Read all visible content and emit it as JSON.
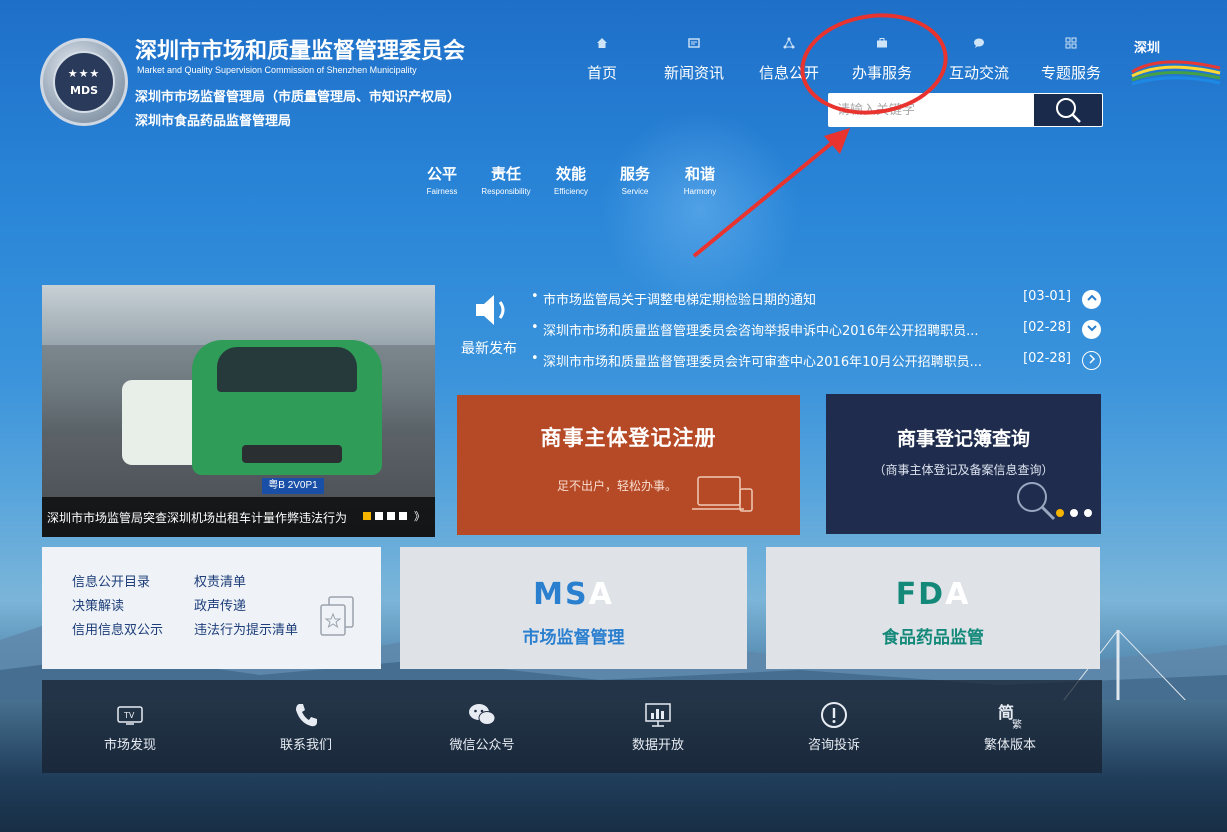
{
  "org": {
    "name_cn": "深圳市市场和质量监督管理委员会",
    "name_en": "Market and Quality Supervision Commission of Shenzhen Municipality",
    "sub1": "深圳市市场监督管理局（市质量管理局、市知识产权局）",
    "sub2": "深圳市食品药品监督管理局",
    "logo_text": "MDS"
  },
  "nav": [
    {
      "label": "首页",
      "icon": "home-icon"
    },
    {
      "label": "新闻资讯",
      "icon": "news-icon"
    },
    {
      "label": "信息公开",
      "icon": "share-icon"
    },
    {
      "label": "办事服务",
      "icon": "briefcase-icon"
    },
    {
      "label": "互动交流",
      "icon": "chat-icon"
    },
    {
      "label": "专题服务",
      "icon": "grid-icon"
    }
  ],
  "search": {
    "placeholder": "请输入关键字"
  },
  "values": [
    {
      "cn": "公平",
      "en": "Fairness"
    },
    {
      "cn": "责任",
      "en": "Responsibility"
    },
    {
      "cn": "效能",
      "en": "Efficiency"
    },
    {
      "cn": "服务",
      "en": "Service"
    },
    {
      "cn": "和谐",
      "en": "Harmony"
    }
  ],
  "carousel": {
    "caption": "深圳市市场监管局突查深圳机场出租车计量作弊违法行为",
    "plate": "粤B 2V0P1",
    "next": "》"
  },
  "news": {
    "label": "最新发布",
    "items": [
      {
        "title": "市市场监管局关于调整电梯定期检验日期的通知",
        "date": "[03-01]"
      },
      {
        "title": "深圳市市场和质量监督管理委员会咨询举报申诉中心2016年公开招聘职员...",
        "date": "[02-28]"
      },
      {
        "title": "深圳市市场和质量监督管理委员会许可审查中心2016年10月公开招聘职员...",
        "date": "[02-28]"
      }
    ]
  },
  "tiles": {
    "register": {
      "title": "商事主体登记注册",
      "sub": "足不出户，轻松办事。"
    },
    "query": {
      "title": "商事登记簿查询",
      "sub": "（商事主体登记及备案信息查询）"
    },
    "links": [
      "信息公开目录",
      "权责清单",
      "决策解读",
      "政声传递",
      "信用信息双公示",
      "违法行为提示清单"
    ],
    "msa": {
      "logo_main": "MS",
      "logo_a": "A",
      "label": "市场监督管理"
    },
    "fda": {
      "logo_main": "FD",
      "logo_a": "A",
      "label": "食品药品监管"
    }
  },
  "footer": [
    {
      "label": "市场发现",
      "icon": "tv-icon"
    },
    {
      "label": "联系我们",
      "icon": "phone-icon"
    },
    {
      "label": "微信公众号",
      "icon": "wechat-icon"
    },
    {
      "label": "数据开放",
      "icon": "chart-icon"
    },
    {
      "label": "咨询投诉",
      "icon": "alert-icon"
    },
    {
      "label": "繁体版本",
      "icon": "traditional-icon"
    }
  ],
  "colors": {
    "accent_orange": "#b64a27",
    "accent_navy": "#1f2c4d",
    "msa_blue": "#2a7fcf",
    "fda_teal": "#14897a",
    "annotation_red": "#e8332f"
  }
}
